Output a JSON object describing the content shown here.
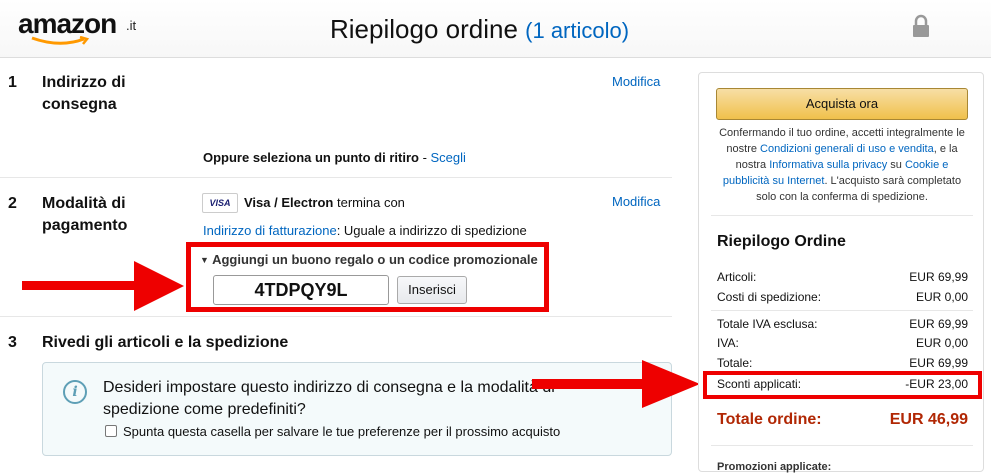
{
  "header": {
    "logo_text": "amazon",
    "logo_suffix": ".it",
    "title": "Riepilogo ordine",
    "item_count": "(1 articolo)"
  },
  "sections": {
    "address": {
      "number": "1",
      "title": "Indirizzo di consegna",
      "edit": "Modifica",
      "pickup_text": "Oppure seleziona un punto di ritiro",
      "pickup_sep": " - ",
      "pickup_link": "Scegli"
    },
    "payment": {
      "number": "2",
      "title": "Modalità di pagamento",
      "edit": "Modifica",
      "card_logo": "VISA",
      "card_name": "Visa / Electron",
      "card_suffix": "termina con",
      "billing_link": "Indirizzo di fatturazione",
      "billing_text": ": Uguale a indirizzo di spedizione",
      "gift_toggle": "Aggiungi un buono regalo o un codice promozionale",
      "gift_code": "4TDPQY9L",
      "apply_button": "Inserisci"
    },
    "review": {
      "number": "3",
      "title": "Rivedi gli articoli e la spedizione",
      "info_icon": "i",
      "info_text": "Desideri impostare questo indirizzo di consegna e la modalità di spedizione come predefiniti?",
      "checkbox_label": "Spunta questa casella per salvare le tue preferenze per il prossimo acquisto"
    }
  },
  "sidebar": {
    "buy_button": "Acquista ora",
    "note_1": "Confermando il tuo ordine, accetti integralmente le nostre ",
    "note_link_1": "Condizioni generali di uso e vendita",
    "note_2": ", e la nostra ",
    "note_link_2": "Informativa sulla privacy",
    "note_3": " su ",
    "note_link_3": "Cookie e pubblicità su Internet",
    "note_4": ". L'acquisto sarà completato solo con la conferma di spedizione.",
    "summary_title": "Riepilogo Ordine",
    "rows": [
      {
        "label": "Articoli:",
        "value": "EUR 69,99"
      },
      {
        "label": "Costi di spedizione:",
        "value": "EUR 0,00"
      },
      {
        "label": "Totale IVA esclusa:",
        "value": "EUR 69,99"
      },
      {
        "label": "IVA:",
        "value": "EUR 0,00"
      },
      {
        "label": "Totale:",
        "value": "EUR 69,99"
      },
      {
        "label": "Sconti applicati:",
        "value": "-EUR 23,00"
      }
    ],
    "total_label": "Totale ordine:",
    "total_value": "EUR 46,99",
    "promo_label": "Promozioni applicate:"
  },
  "colors": {
    "link": "#0066c0",
    "highlight": "#ee0000",
    "total": "#b12704",
    "button": "#f0c14b"
  }
}
